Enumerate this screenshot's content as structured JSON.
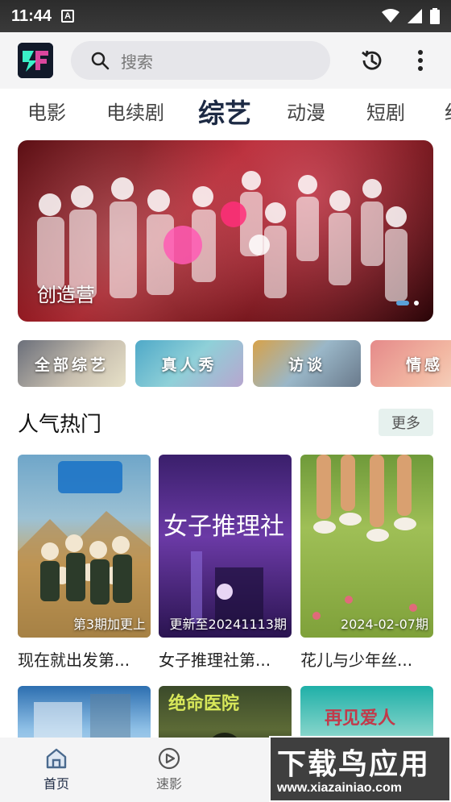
{
  "status_bar": {
    "time": "11:44",
    "notification_icon": "a-icon"
  },
  "header": {
    "search_placeholder": "搜索",
    "logo_icon": "app-logo"
  },
  "tabs": [
    {
      "label": "电影"
    },
    {
      "label": "电续剧"
    },
    {
      "label": "综艺",
      "active": true
    },
    {
      "label": "动漫"
    },
    {
      "label": "短剧"
    },
    {
      "label": "纪"
    }
  ],
  "banner": {
    "title": "创造营"
  },
  "categories": [
    {
      "label": "全部综艺"
    },
    {
      "label": "真人秀"
    },
    {
      "label": "访谈"
    },
    {
      "label": "情感"
    }
  ],
  "section": {
    "title": "人气热门",
    "more_label": "更多"
  },
  "cards": [
    {
      "name": "现在就出发第...",
      "badge": "第3期加更上"
    },
    {
      "name": "女子推理社第...",
      "badge": "更新至20241113期",
      "poster_text": "女子推理社"
    },
    {
      "name": "花儿与少年丝...",
      "badge": "2024-02-07期"
    }
  ],
  "second_row": [
    {
      "poster_text": ""
    },
    {
      "poster_text": "绝命医院"
    },
    {
      "poster_text": "再见爱人"
    }
  ],
  "bottom_nav": [
    {
      "label": "首页",
      "active": true
    },
    {
      "label": "速影"
    }
  ],
  "watermark": {
    "line1": "下载鸟应用",
    "line2": "www.xiazainiao.com"
  },
  "colors": {
    "active_tab": "#1d2a44",
    "more_bg": "#e6f1ee",
    "search_bg": "#e6e6ea"
  }
}
